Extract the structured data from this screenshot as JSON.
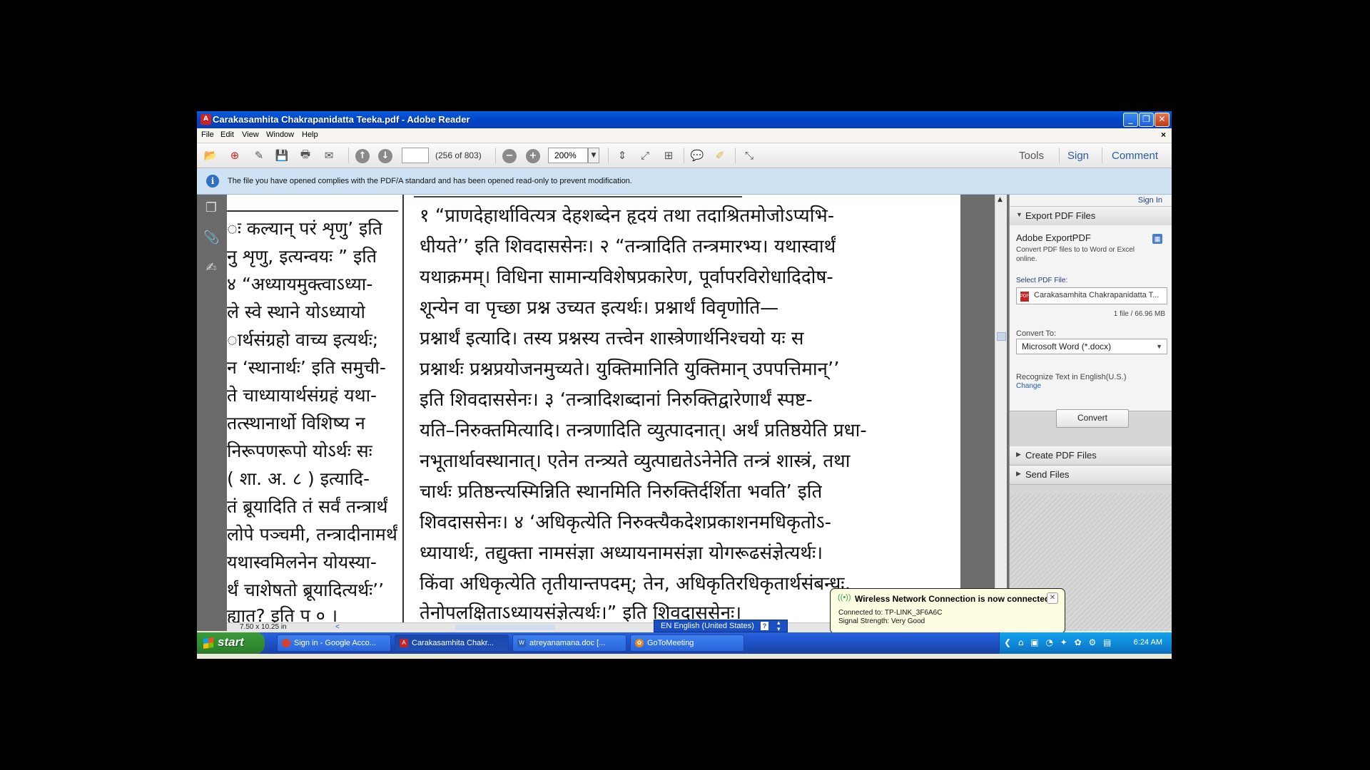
{
  "window": {
    "title": "Carakasamhita Chakrapanidatta Teeka.pdf - Adobe Reader",
    "app_icon": "pdf-icon",
    "controls": {
      "minimize": "_",
      "restore": "❐",
      "close": "✕"
    }
  },
  "menu": {
    "items": [
      "File",
      "Edit",
      "View",
      "Window",
      "Help"
    ],
    "doc_close": "×"
  },
  "toolbar": {
    "page_input": "",
    "page_count": "(256 of 803)",
    "zoom": "200%",
    "links": {
      "tools": "Tools",
      "sign": "Sign",
      "comment": "Comment"
    },
    "icons": {
      "open": "📂",
      "create": "⊕",
      "edit": "✎",
      "save": "💾",
      "print": "🖶",
      "email": "✉",
      "prev_page": "↑",
      "next_page": "↓",
      "zoom_out": "−",
      "zoom_in": "+",
      "fit_page": "⇕",
      "fit_width": "⤢",
      "scroll": "⊞",
      "comment_bubble": "💬",
      "highlight": "✐",
      "fullscreen": "⤡"
    }
  },
  "infobar": {
    "icon": "i",
    "text": "The file you have opened complies with the PDF/A standard and has been opened read-only to prevent modification."
  },
  "leftnav": {
    "icons": [
      "pages-icon",
      "attachment-icon",
      "signature-icon"
    ]
  },
  "document": {
    "left_column": [
      "ः कल्यान् परं शृणु’ इति",
      "नु शृणु, इत्यन्वयः ” इति",
      "४ “अध्यायमुक्त्वाऽध्या-",
      "ले स्वे स्थाने योऽध्यायो",
      "ार्थसंग्रहो वाच्य इत्यर्थः;",
      "न ‘स्थानार्थः’ इति समुची-",
      "ते चाध्यायार्थसंग्रहं यथा-",
      " तत्स्थानार्थो विशिष्य न",
      "निरूपणरूपो योऽर्थः सः",
      " ( शा. अ. ८ ) इत्यादि-",
      "तं ब्रूयादिति तं सर्वं तन्त्रार्थं",
      "लोपे पञ्चमी, तन्त्रादीनामर्थं",
      " यथास्वमिलनेन योयस्या-",
      "र्थं चाशेषतो ब्रूयादित्यर्थः’’",
      "ह्यात्? इति प ० ।"
    ],
    "right_column": [
      "१ “प्राणदेहार्थावित्यत्र देहशब्देन हृदयं तथा तदाश्रितमोजोऽप्यभि-",
      "धीयते’’ इति शिवदाससेनः। २ “तन्त्रादिति तन्त्रमारभ्य। यथास्वार्थं",
      "यथाक्रमम्। विधिना सामान्यविशेषप्रकारेण, पूर्वापरविरोधादिदोष-",
      "शून्येन वा पृच्छा प्रश्न उच्यत इत्यर्थः। प्रश्नार्थं विवृणोति—",
      "प्रश्नार्थं इत्यादि। तस्य प्रश्नस्य तत्त्वेन शास्त्रेणार्थनिश्चयो यः स",
      "प्रश्नार्थः प्रश्नप्रयोजनमुच्यते। युक्तिमानिति युक्तिमान् उपपत्तिमान्’’",
      "इति शिवदाससेनः। ३ ‘तन्त्रादिशब्दानां निरुक्तिद्वारेणार्थं स्पष्ट-",
      "यति–निरुक्तमित्यादि। तन्त्रणादिति व्युत्पादनात्। अर्थं प्रतिष्ठयेति प्रधा-",
      "नभूतार्थावस्थानात्। एतेन तन्त्र्यते व्युत्पाद्यतेऽनेनेति तन्त्रं शास्त्रं, तथा",
      "चार्थः प्रतिष्ठन्त्यस्मिन्निति स्थानमिति निरुक्तिर्दर्शिता भवति’ इति",
      "शिवदाससेनः। ४ ‘अधिकृत्येति निरुक्त्यैकदेशप्रकाशनमधिकृतोऽ-",
      "ध्यायार्थः, तद्युक्ता नामसंज्ञा अध्यायनामसंज्ञा योगरूढसंज्ञेत्यर्थः।",
      "किंवा अधिकृत्येति तृतीयान्तपदम्; तेन, अधिकृतिरधिकृतार्थसंबन्धः,",
      "तेनोपलक्षिताऽध्यायसंज्ञेत्यर्थः।” इति शिवदाससेनः।"
    ],
    "page_size": "7.50 x 10.25 in",
    "scroll_left": "<",
    "scroll_up": "▲"
  },
  "rightpane": {
    "sign_in": "Sign In",
    "export_header": "Export PDF Files",
    "adobe_export": "Adobe ExportPDF",
    "description": "Convert PDF files to to Word or Excel online.",
    "select_label": "Select PDF File:",
    "file_name": "Carakasamhita Chakrapanidatta T...",
    "file_meta": "1 file / 66.96 MB",
    "convert_to_label": "Convert To:",
    "convert_option": "Microsoft Word (*.docx)",
    "recognize": "Recognize Text in English(U.S.)",
    "change": "Change",
    "convert_button": "Convert",
    "create_header": "Create PDF Files",
    "send_header": "Send Files",
    "expanded_arrow": "▼",
    "collapsed_arrow": "▶"
  },
  "balloon": {
    "title": "Wireless Network Connection is now connected",
    "connected_to": "Connected to: TP-LINK_3F6A6C",
    "signal": "Signal Strength: Very Good",
    "close": "✕"
  },
  "language_bar": {
    "language": "EN English (United States)",
    "help": "?"
  },
  "taskbar": {
    "start": "start",
    "tasks": [
      {
        "label": "Sign in - Google Acco...",
        "icon": "chrome-icon",
        "color": "#d8422c"
      },
      {
        "label": "Carakasamhita Chakr...",
        "icon": "adobe-reader-icon",
        "color": "#c02626"
      },
      {
        "label": "atreyanamana.doc [...",
        "icon": "word-document-icon",
        "color": "#2b5fb8"
      },
      {
        "label": "GoToMeeting",
        "icon": "gotomeeting-icon",
        "color": "#e08a1e"
      }
    ],
    "clock": "6:24 AM"
  }
}
